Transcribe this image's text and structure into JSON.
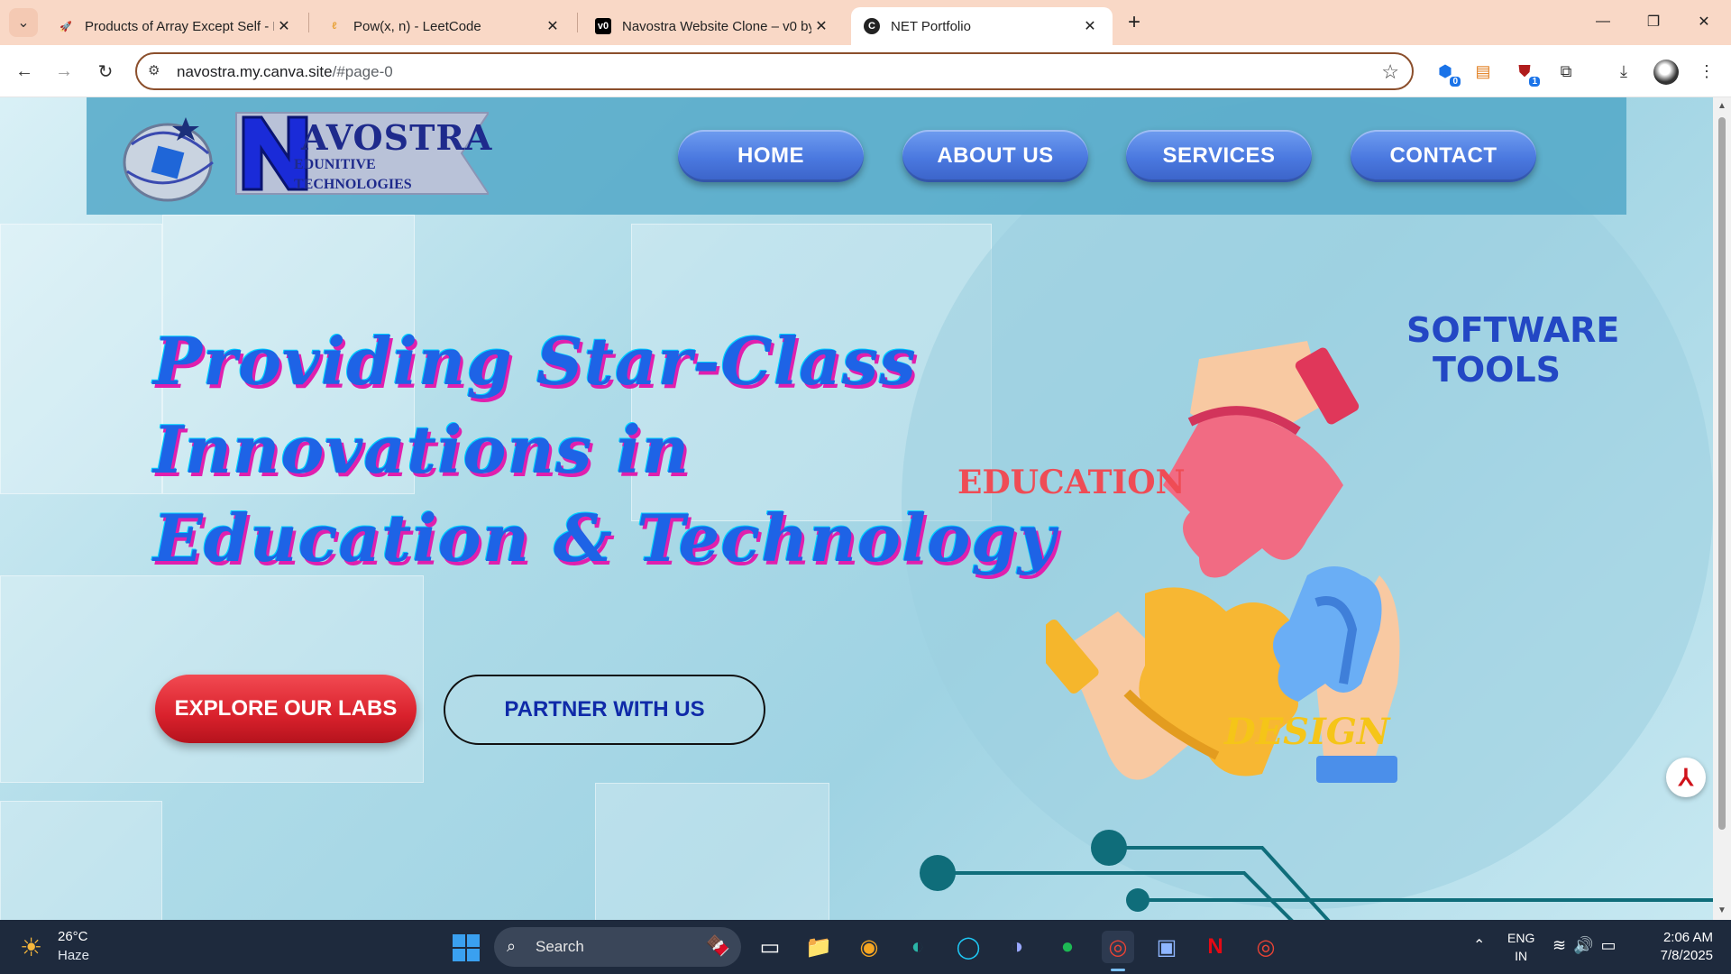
{
  "browser": {
    "tabs": [
      {
        "title": "Products of Array Except Self - L",
        "favicon": "rocket-icon",
        "active": false
      },
      {
        "title": "Pow(x, n) - LeetCode",
        "favicon": "leetcode-icon",
        "active": false
      },
      {
        "title": "Navostra Website Clone – v0 by",
        "favicon": "v0-icon",
        "active": false
      },
      {
        "title": "NET Portfolio",
        "favicon": "canva-icon",
        "active": true
      }
    ],
    "url_host": "navostra.my.canva.site",
    "url_path": "/#page-0",
    "extension_badges": [
      "0",
      "1"
    ]
  },
  "site": {
    "logo": {
      "main": "AVOSTRA",
      "line1": "EDUNITIVE",
      "line2": "TECHNOLOGIES"
    },
    "nav": [
      "HOME",
      "ABOUT US",
      "SERVICES",
      "CONTACT"
    ],
    "hero_lines": [
      "Providing Star-Class",
      "Innovations in",
      "Education & Technology"
    ],
    "cta_primary": "EXPLORE OUR LABS",
    "cta_secondary": "PARTNER WITH US",
    "graphic_labels": {
      "software_1": "SOFTWARE",
      "software_2": "TOOLS",
      "education": "EDUCATION",
      "design": "DESIGN"
    },
    "colors": {
      "hero_text": "#1e63e6",
      "hero_shadow": "#e01fae",
      "nav_button": "#4a78df",
      "cta_primary": "#d9212c",
      "education": "#ef4c55",
      "design": "#f5c518",
      "software": "#2347c4"
    }
  },
  "taskbar": {
    "weather_temp": "26°C",
    "weather_desc": "Haze",
    "search_placeholder": "Search",
    "lang_1": "ENG",
    "lang_2": "IN",
    "time": "2:06 AM",
    "date": "7/8/2025"
  }
}
